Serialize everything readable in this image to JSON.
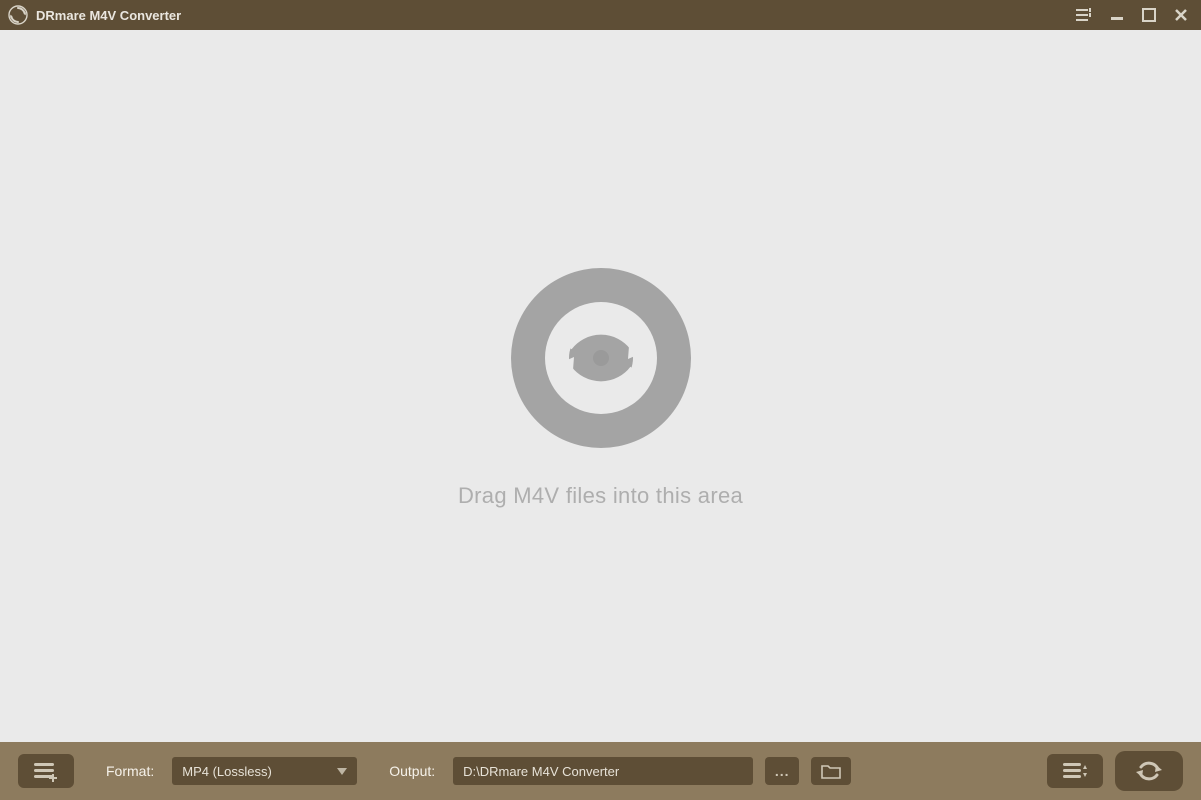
{
  "titlebar": {
    "app_name": "DRmare M4V Converter"
  },
  "main": {
    "drop_hint": "Drag M4V files into this area"
  },
  "footer": {
    "format_label": "Format:",
    "format_value": "MP4 (Lossless)",
    "output_label": "Output:",
    "output_path": "D:\\DRmare M4V Converter",
    "more_label": "..."
  },
  "icons": {
    "app": "cycle-icon",
    "menu": "menu-icon",
    "minimize": "minimize-icon",
    "maximize": "maximize-icon",
    "close": "close-icon",
    "add": "add-files-icon",
    "dropdown": "chevron-down-icon",
    "browse_more": "ellipsis-icon",
    "folder": "folder-icon",
    "list_settings": "list-settings-icon",
    "convert": "convert-icon",
    "dropzone": "cycle-large-icon"
  },
  "colors": {
    "titlebar": "#5e4e36",
    "footer": "#8d7b5e",
    "accent_dark": "#5e4e36",
    "canvas": "#eaeaea",
    "muted_text": "#aeaeae"
  }
}
